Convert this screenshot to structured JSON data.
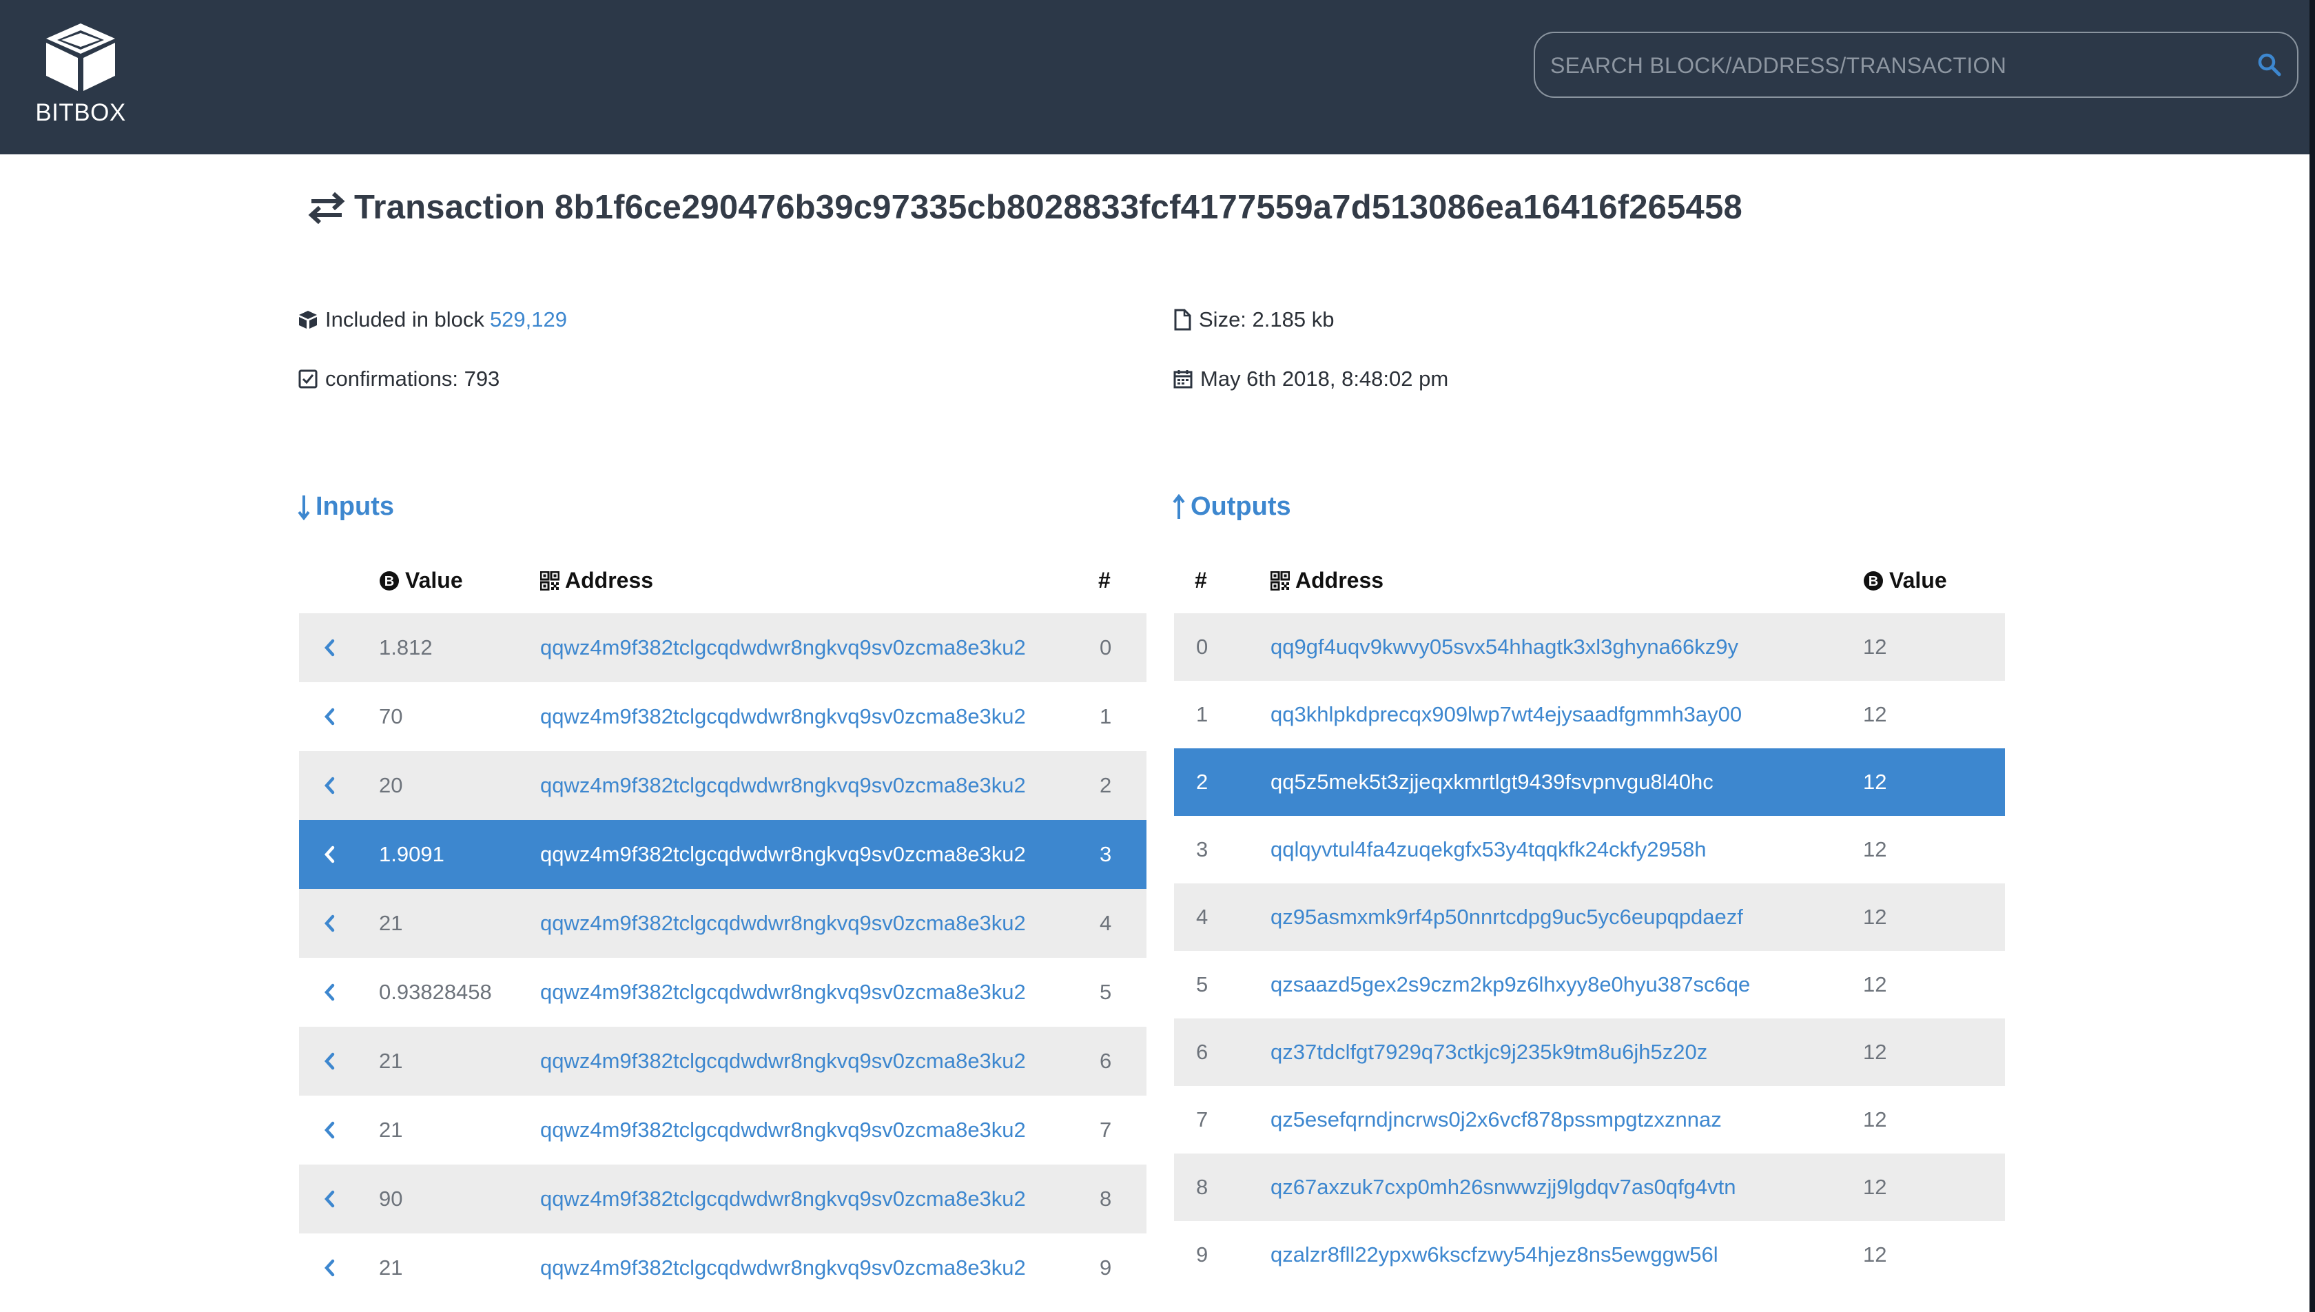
{
  "header": {
    "logo_text": "BITBOX",
    "search_placeholder": "SEARCH BLOCK/ADDRESS/TRANSACTION",
    "bg_color": "#2c3848"
  },
  "title": "Transaction 8b1f6ce290476b39c97335cb8028833fcf4177559a7d513086ea16416f265458",
  "info": {
    "block_label": "Included in block",
    "block_value": "529,129",
    "confirmations": "confirmations: 793",
    "size": "Size: 2.185 kb",
    "date": "May 6th 2018, 8:48:02 pm"
  },
  "inputs": {
    "heading": "Inputs",
    "columns": {
      "value": "Value",
      "address": "Address",
      "index": "#"
    },
    "rows": [
      {
        "value": "1.812",
        "address": "qqwz4m9f382tclgcqdwdwr8ngkvq9sv0zcma8e3ku2",
        "index": "0"
      },
      {
        "value": "70",
        "address": "qqwz4m9f382tclgcqdwdwr8ngkvq9sv0zcma8e3ku2",
        "index": "1"
      },
      {
        "value": "20",
        "address": "qqwz4m9f382tclgcqdwdwr8ngkvq9sv0zcma8e3ku2",
        "index": "2"
      },
      {
        "value": "1.9091",
        "address": "qqwz4m9f382tclgcqdwdwr8ngkvq9sv0zcma8e3ku2",
        "index": "3"
      },
      {
        "value": "21",
        "address": "qqwz4m9f382tclgcqdwdwr8ngkvq9sv0zcma8e3ku2",
        "index": "4"
      },
      {
        "value": "0.93828458",
        "address": "qqwz4m9f382tclgcqdwdwr8ngkvq9sv0zcma8e3ku2",
        "index": "5"
      },
      {
        "value": "21",
        "address": "qqwz4m9f382tclgcqdwdwr8ngkvq9sv0zcma8e3ku2",
        "index": "6"
      },
      {
        "value": "21",
        "address": "qqwz4m9f382tclgcqdwdwr8ngkvq9sv0zcma8e3ku2",
        "index": "7"
      },
      {
        "value": "90",
        "address": "qqwz4m9f382tclgcqdwdwr8ngkvq9sv0zcma8e3ku2",
        "index": "8"
      },
      {
        "value": "21",
        "address": "qqwz4m9f382tclgcqdwdwr8ngkvq9sv0zcma8e3ku2",
        "index": "9"
      }
    ],
    "selected_index": 3
  },
  "outputs": {
    "heading": "Outputs",
    "columns": {
      "index": "#",
      "address": "Address",
      "value": "Value"
    },
    "rows": [
      {
        "index": "0",
        "address": "qq9gf4uqv9kwvy05svx54hhagtk3xl3ghyna66kz9y",
        "value": "12"
      },
      {
        "index": "1",
        "address": "qq3khlpkdprecqx909lwp7wt4ejysaadfgmmh3ay00",
        "value": "12"
      },
      {
        "index": "2",
        "address": "qq5z5mek5t3zjjeqxkmrtlgt9439fsvpnvgu8l40hc",
        "value": "12"
      },
      {
        "index": "3",
        "address": "qqlqyvtul4fa4zuqekgfx53y4tqqkfk24ckfy2958h",
        "value": "12"
      },
      {
        "index": "4",
        "address": "qz95asmxmk9rf4p50nnrtcdpg9uc5yc6eupqpdaezf",
        "value": "12"
      },
      {
        "index": "5",
        "address": "qzsaazd5gex2s9czm2kp9z6lhxyy8e0hyu387sc6qe",
        "value": "12"
      },
      {
        "index": "6",
        "address": "qz37tdclfgt7929q73ctkjc9j235k9tm8u6jh5z20z",
        "value": "12"
      },
      {
        "index": "7",
        "address": "qz5esefqrndjncrws0j2x6vcf878pssmpgtzxznnaz",
        "value": "12"
      },
      {
        "index": "8",
        "address": "qz67axzuk7cxp0mh26snwwzjj9lgdqv7as0qfg4vtn",
        "value": "12"
      },
      {
        "index": "9",
        "address": "qzalzr8fll22ypxw6kscfzwy54hjez8ns5ewggw56l",
        "value": "12"
      }
    ],
    "selected_index": 2
  },
  "colors": {
    "accent": "#3d87cf",
    "row_alt": "#ececec",
    "header_bg": "#2c3848"
  }
}
